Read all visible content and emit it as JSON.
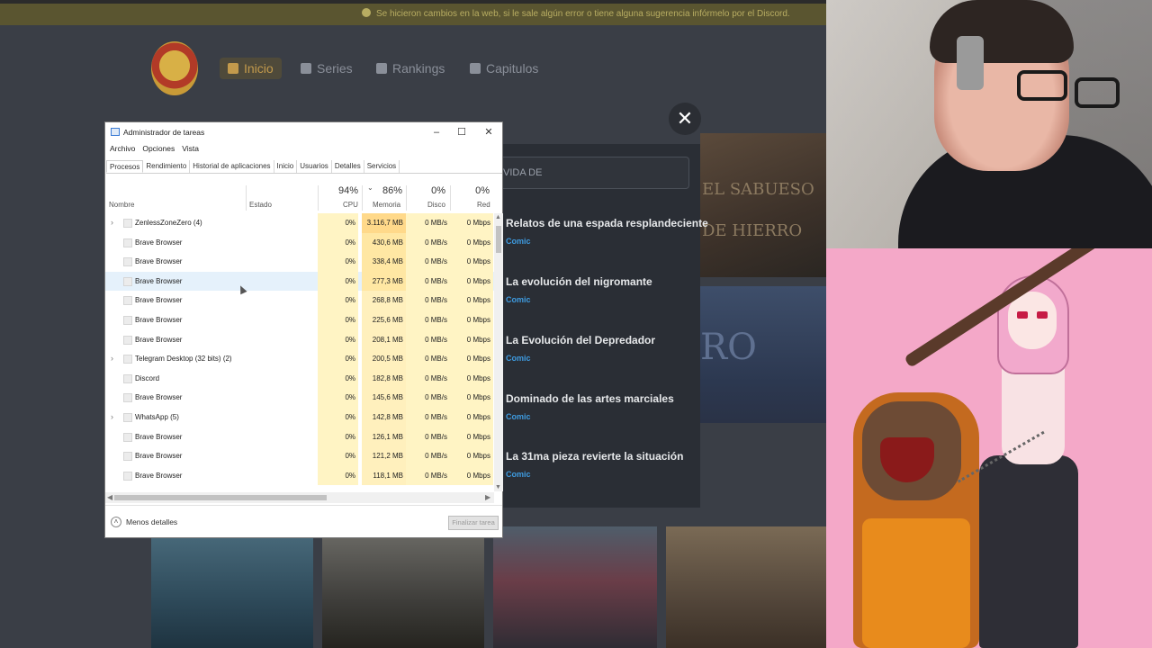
{
  "site": {
    "notice": "Se hicieron cambios en la web, si le sale algún error o tiene alguna sugerencia infórmelo por el Discord.",
    "nav": [
      {
        "label": "Inicio",
        "icon": "home-icon"
      },
      {
        "label": "Series",
        "icon": "book-icon"
      },
      {
        "label": "Rankings",
        "icon": "trend-icon"
      },
      {
        "label": "Capitulos",
        "icon": "copy-icon"
      }
    ],
    "search_text": "VIDA DE",
    "results": [
      {
        "title": "Relatos de una espada resplandeciente",
        "kind": "Comic"
      },
      {
        "title": "La evolución del nigromante",
        "kind": "Comic"
      },
      {
        "title": "La Evolución del Depredador",
        "kind": "Comic"
      },
      {
        "title": "Dominado de las artes marciales",
        "kind": "Comic"
      },
      {
        "title": "La 31ma pieza revierte la situación",
        "kind": "Comic"
      }
    ],
    "cover_texts": {
      "cov1": "EL SABUESO DE HIERRO",
      "cov2": "RO"
    }
  },
  "taskmanager": {
    "title": "Administrador de tareas",
    "menu": [
      "Archivo",
      "Opciones",
      "Vista"
    ],
    "tabs": [
      "Procesos",
      "Rendimiento",
      "Historial de aplicaciones",
      "Inicio",
      "Usuarios",
      "Detalles",
      "Servicios"
    ],
    "columns": {
      "name": "Nombre",
      "status": "Estado",
      "cpu_pct": "94%",
      "cpu": "CPU",
      "mem_pct": "86%",
      "mem": "Memoria",
      "disk_pct": "0%",
      "disk": "Disco",
      "net_pct": "0%",
      "net": "Red"
    },
    "rows": [
      {
        "name": "ZenlessZoneZero (4)",
        "expand": true,
        "cpu": "0%",
        "mem": "3.116,7 MB",
        "disk": "0 MB/s",
        "net": "0 Mbps"
      },
      {
        "name": "Brave Browser",
        "expand": false,
        "cpu": "0%",
        "mem": "430,6 MB",
        "disk": "0 MB/s",
        "net": "0 Mbps"
      },
      {
        "name": "Brave Browser",
        "expand": false,
        "cpu": "0%",
        "mem": "338,4 MB",
        "disk": "0 MB/s",
        "net": "0 Mbps"
      },
      {
        "name": "Brave Browser",
        "expand": false,
        "cpu": "0%",
        "mem": "277,3 MB",
        "disk": "0 MB/s",
        "net": "0 Mbps"
      },
      {
        "name": "Brave Browser",
        "expand": false,
        "cpu": "0%",
        "mem": "268,8 MB",
        "disk": "0 MB/s",
        "net": "0 Mbps"
      },
      {
        "name": "Brave Browser",
        "expand": false,
        "cpu": "0%",
        "mem": "225,6 MB",
        "disk": "0 MB/s",
        "net": "0 Mbps"
      },
      {
        "name": "Brave Browser",
        "expand": false,
        "cpu": "0%",
        "mem": "208,1 MB",
        "disk": "0 MB/s",
        "net": "0 Mbps"
      },
      {
        "name": "Telegram Desktop (32 bits) (2)",
        "expand": true,
        "cpu": "0%",
        "mem": "200,5 MB",
        "disk": "0 MB/s",
        "net": "0 Mbps"
      },
      {
        "name": "Discord",
        "expand": false,
        "cpu": "0%",
        "mem": "182,8 MB",
        "disk": "0 MB/s",
        "net": "0 Mbps"
      },
      {
        "name": "Brave Browser",
        "expand": false,
        "cpu": "0%",
        "mem": "145,6 MB",
        "disk": "0 MB/s",
        "net": "0 Mbps"
      },
      {
        "name": "WhatsApp (5)",
        "expand": true,
        "cpu": "0%",
        "mem": "142,8 MB",
        "disk": "0 MB/s",
        "net": "0 Mbps"
      },
      {
        "name": "Brave Browser",
        "expand": false,
        "cpu": "0%",
        "mem": "126,1 MB",
        "disk": "0 MB/s",
        "net": "0 Mbps"
      },
      {
        "name": "Brave Browser",
        "expand": false,
        "cpu": "0%",
        "mem": "121,2 MB",
        "disk": "0 MB/s",
        "net": "0 Mbps"
      },
      {
        "name": "Brave Browser",
        "expand": false,
        "cpu": "0%",
        "mem": "118,1 MB",
        "disk": "0 MB/s",
        "net": "0 Mbps"
      }
    ],
    "selected_row": 3,
    "fewer_details": "Menos detalles",
    "end_task": "Finalizar tarea"
  },
  "colors": {
    "cpu_heat": "#fff4c4",
    "mem_heat_high": "#ffd98a",
    "mem_heat_mid": "#ffe7a3",
    "mem_heat_low": "#fff0bd",
    "accent_link": "#3e9be0",
    "nav_active": "#c39a4c"
  }
}
